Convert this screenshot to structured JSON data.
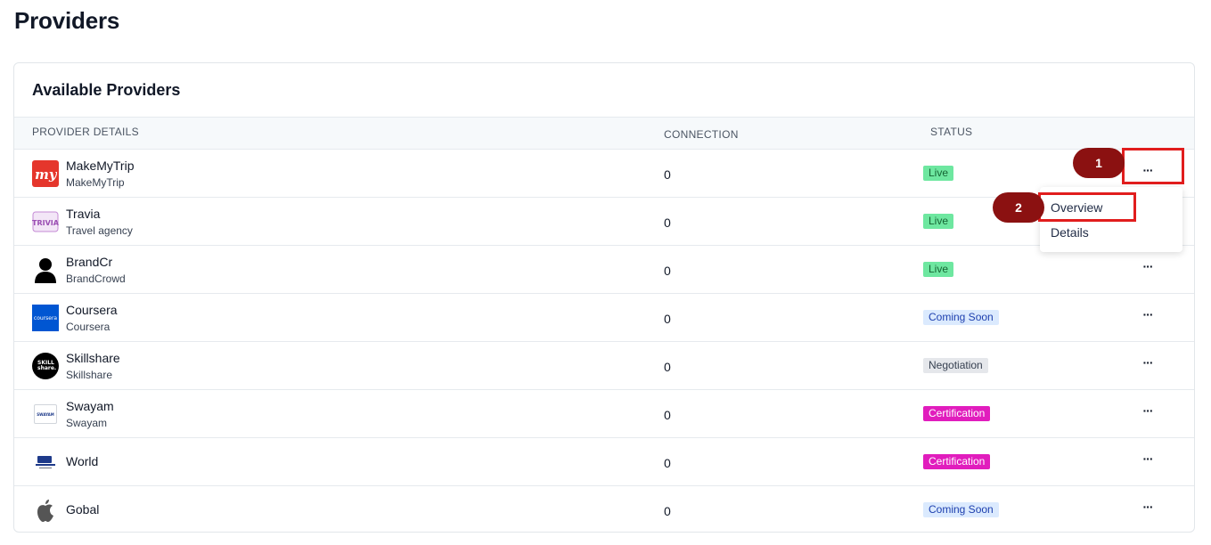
{
  "page": {
    "title": "Providers"
  },
  "card": {
    "title": "Available Providers"
  },
  "table": {
    "columns": {
      "details": "PROVIDER DETAILS",
      "connection": "CONNECTION",
      "status": "STATUS"
    },
    "rows": [
      {
        "name": "MakeMyTrip",
        "sub": "MakeMyTrip",
        "connection": "0",
        "status": "Live",
        "logo": "makemytrip-logo"
      },
      {
        "name": "Travia",
        "sub": "Travel agency",
        "connection": "0",
        "status": "Live",
        "logo": "travia-logo"
      },
      {
        "name": "BrandCr",
        "sub": "BrandCrowd",
        "connection": "0",
        "status": "Live",
        "logo": "person-icon"
      },
      {
        "name": "Coursera",
        "sub": "Coursera",
        "connection": "0",
        "status": "Coming Soon",
        "logo": "coursera-logo",
        "logo_text": "coursera"
      },
      {
        "name": "Skillshare",
        "sub": "Skillshare",
        "connection": "0",
        "status": "Negotiation",
        "logo": "skillshare-logo",
        "logo_text": "SKILL share."
      },
      {
        "name": "Swayam",
        "sub": "Swayam",
        "connection": "0",
        "status": "Certification",
        "logo": "swayam-logo",
        "logo_text": "SWAYAM"
      },
      {
        "name": "World",
        "sub": "",
        "connection": "0",
        "status": "Certification",
        "logo": "world-logo"
      },
      {
        "name": "Gobal",
        "sub": "",
        "connection": "0",
        "status": "Coming Soon",
        "logo": "apple-icon"
      }
    ],
    "more_label": "···"
  },
  "menu": {
    "overview": "Overview",
    "details": "Details"
  },
  "annotations": {
    "marker_1": "1",
    "marker_2": "2"
  },
  "colors": {
    "live": "#6ee7a0",
    "coming_soon": "#dbeafe",
    "negotiation": "#e5e7eb",
    "certification": "#e11dbd",
    "annotation_red": "#e11d1d",
    "marker_fill": "#8b1111"
  }
}
